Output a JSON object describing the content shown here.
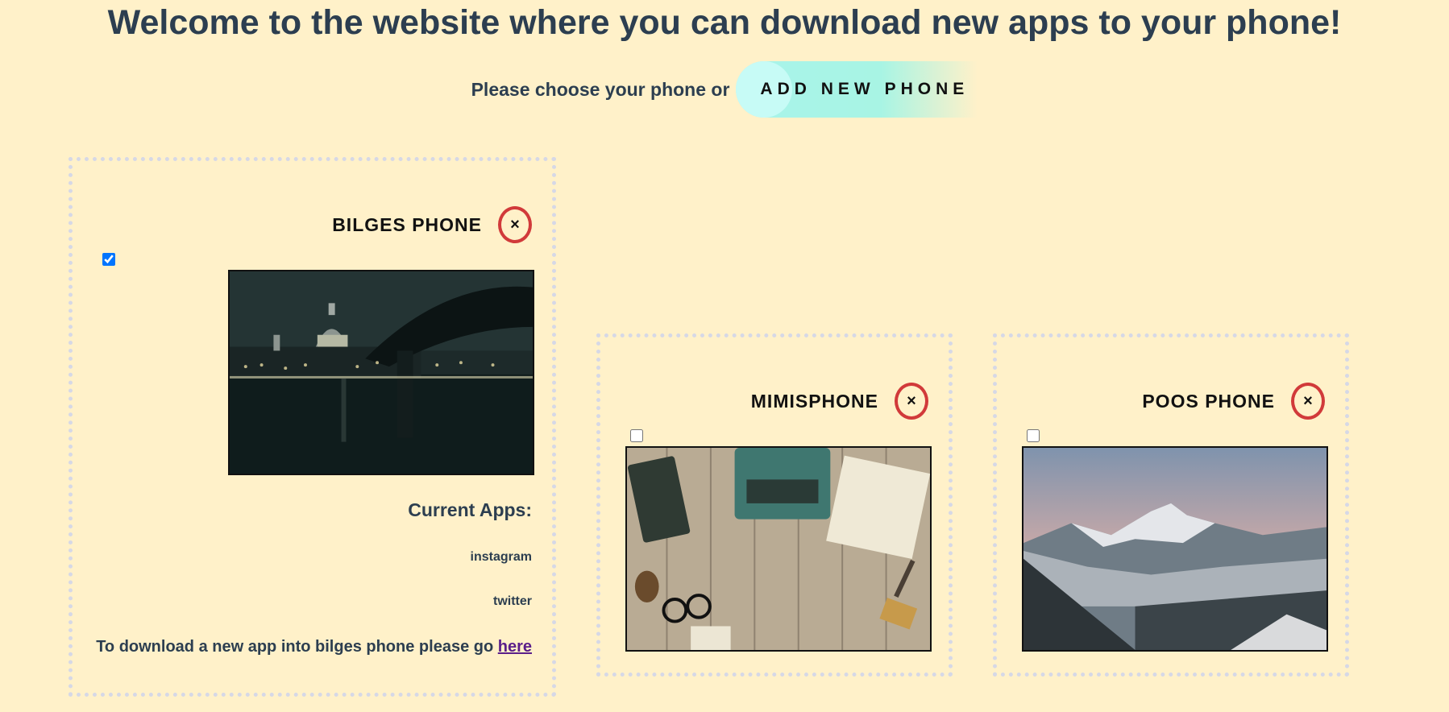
{
  "header": {
    "title": "Welcome to the website where you can download new apps to your phone!",
    "subtitle": "Please choose your phone or",
    "add_button_label": "ADD NEW PHONE"
  },
  "phones": [
    {
      "name": "BILGES PHONE",
      "close_label": "×",
      "checked": true,
      "image": "city-night-icon",
      "apps_title": "Current Apps:",
      "apps": [
        "instagram",
        "twitter"
      ],
      "download_text": "To download a new app into bilges phone please go",
      "download_link": "here"
    },
    {
      "name": "MIMISPHONE",
      "close_label": "×",
      "checked": false,
      "image": "typewriter-desk-icon"
    },
    {
      "name": "POOS PHONE",
      "close_label": "×",
      "checked": false,
      "image": "mountain-landscape-icon"
    }
  ],
  "colors": {
    "background": "#fff1c9",
    "text": "#2c3e50",
    "close_ring": "#d13a3a",
    "button_gradient": "#a8f4ea",
    "link": "#5a1e8a"
  }
}
